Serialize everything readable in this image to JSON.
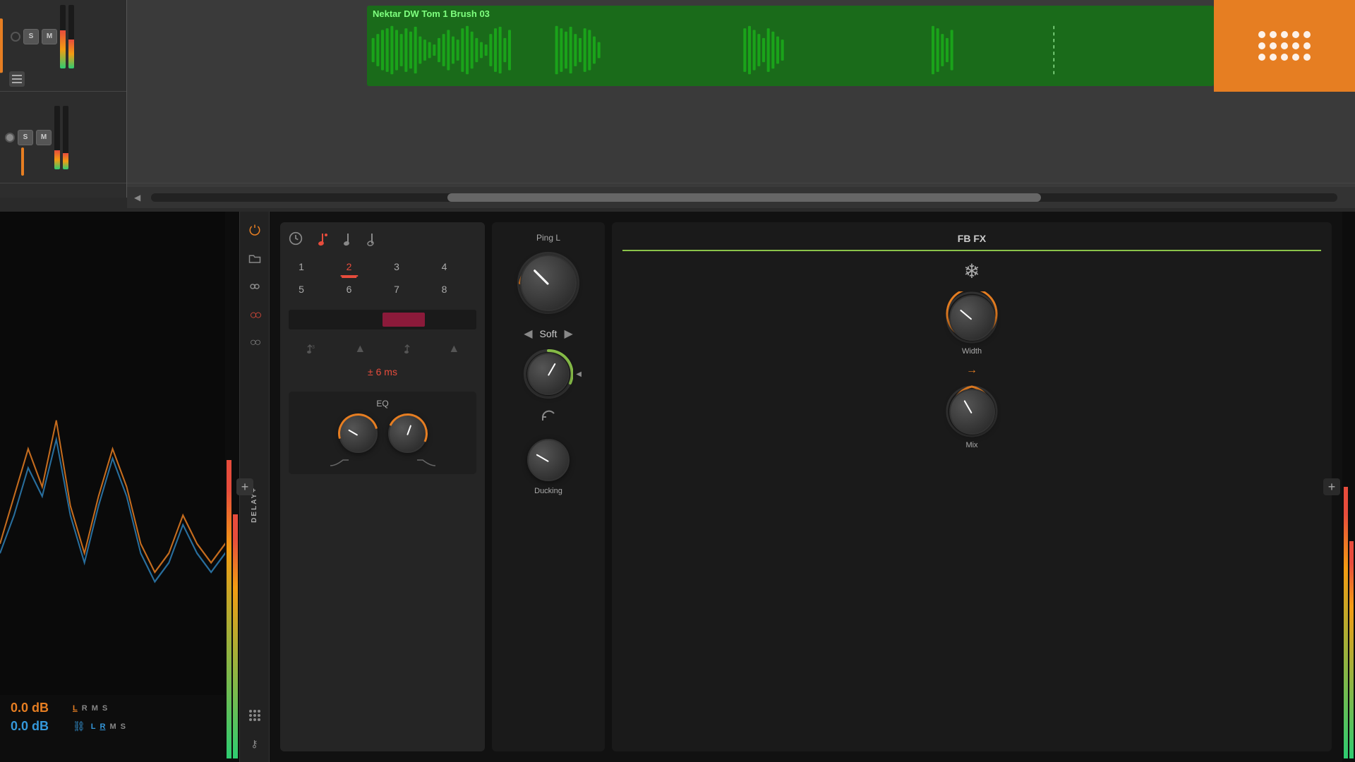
{
  "daw": {
    "track1": {
      "s_label": "S",
      "m_label": "M"
    },
    "track2": {
      "s_label": "S",
      "m_label": "M"
    },
    "clip": {
      "title": "Nektar DW Tom 1 Brush 03"
    },
    "scrollbar_label": ""
  },
  "analyzer": {
    "db_orange": "0.0 dB",
    "db_blue": "0.0 dB",
    "lrms_orange": [
      "L",
      "R",
      "M",
      "S"
    ],
    "lrms_blue": [
      "L",
      "R",
      "M",
      "S"
    ]
  },
  "plugin": {
    "name": "DELAY+",
    "sidebar_icons": [
      "power",
      "folder",
      "link",
      "circle-pair",
      "mic-pair"
    ],
    "time_icons": [
      "clock",
      "note-eighth-dotted",
      "note-quarter",
      "note-half"
    ],
    "numbers": [
      "1",
      "2",
      "3",
      "4",
      "5",
      "6",
      "7",
      "8"
    ],
    "active_number": "2",
    "time_value": "± 6 ms",
    "sections": {
      "main_knob": {
        "label": "Soft",
        "prev_arrow": "◀",
        "next_arrow": "▶"
      },
      "width_knob": {
        "label": "Width"
      },
      "ducking_knob": {
        "label": "Ducking"
      },
      "mix_knob": {
        "label": "Mix"
      },
      "eq_label": "EQ",
      "fbfx_label": "FB FX"
    },
    "ping_label": "Ping L",
    "add_button": "+"
  }
}
